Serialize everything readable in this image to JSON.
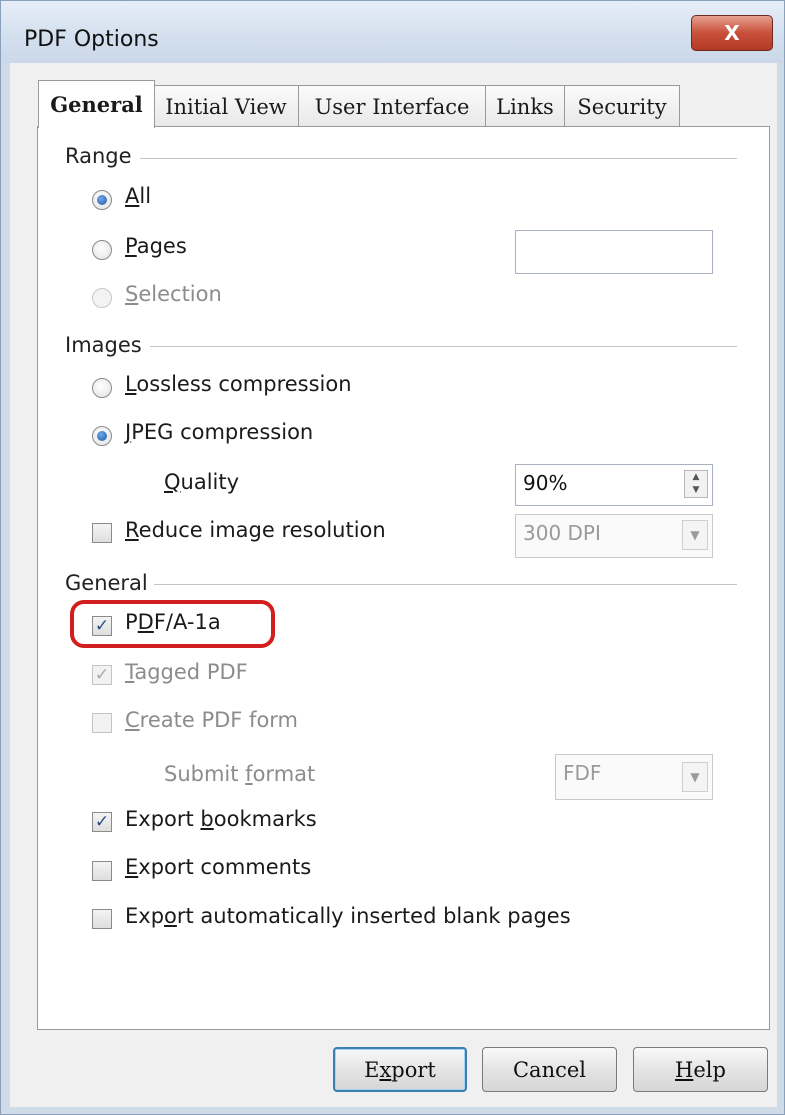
{
  "window": {
    "title": "PDF Options",
    "close_label": "X"
  },
  "tabs": [
    {
      "label": "General",
      "active": true
    },
    {
      "label": "Initial View"
    },
    {
      "label": "User Interface"
    },
    {
      "label": "Links"
    },
    {
      "label": "Security"
    }
  ],
  "range": {
    "heading": "Range",
    "all": {
      "pre": "",
      "key": "A",
      "post": "ll",
      "selected": true
    },
    "pages": {
      "pre": "",
      "key": "P",
      "post": "ages",
      "selected": false,
      "value": ""
    },
    "selection": {
      "pre": "",
      "key": "S",
      "post": "election",
      "selected": false,
      "disabled": true
    }
  },
  "images": {
    "heading": "Images",
    "lossless": {
      "pre": "",
      "key": "L",
      "post": "ossless compression",
      "selected": false
    },
    "jpeg": {
      "pre": "",
      "key": "J",
      "post": "PEG compression",
      "selected": true
    },
    "quality": {
      "pre": "",
      "key": "Q",
      "post": "uality",
      "value": "90%"
    },
    "reduce": {
      "pre": "",
      "key": "R",
      "post": "educe image resolution",
      "checked": false,
      "value": "300 DPI"
    }
  },
  "general": {
    "heading": "General",
    "pdfa": {
      "pre": "P",
      "key": "D",
      "post": "F/A-1a",
      "checked": true
    },
    "tagged": {
      "pre": "",
      "key": "T",
      "post": "agged PDF",
      "checked": true,
      "disabled": true
    },
    "createform": {
      "pre": "",
      "key": "C",
      "post": "reate PDF form",
      "checked": false,
      "disabled": true
    },
    "submit": {
      "pre": "Submit ",
      "key": "f",
      "post": "ormat",
      "value": "FDF",
      "disabled": true
    },
    "bookmarks": {
      "pre": "Export ",
      "key": "b",
      "post": "ookmarks",
      "checked": true
    },
    "comments": {
      "pre": "",
      "key": "E",
      "post": "xport comments",
      "checked": false
    },
    "blankpages": {
      "pre": "Exp",
      "key": "o",
      "post": "rt automatically inserted blank pages",
      "checked": false
    }
  },
  "buttons": {
    "export": {
      "pre": "E",
      "key": "x",
      "post": "port"
    },
    "cancel": "Cancel",
    "help": {
      "pre": "",
      "key": "H",
      "post": "elp"
    }
  },
  "check_mark": "✓",
  "spin_up": "▲",
  "spin_down": "▼",
  "dropdown_arrow": "▼"
}
